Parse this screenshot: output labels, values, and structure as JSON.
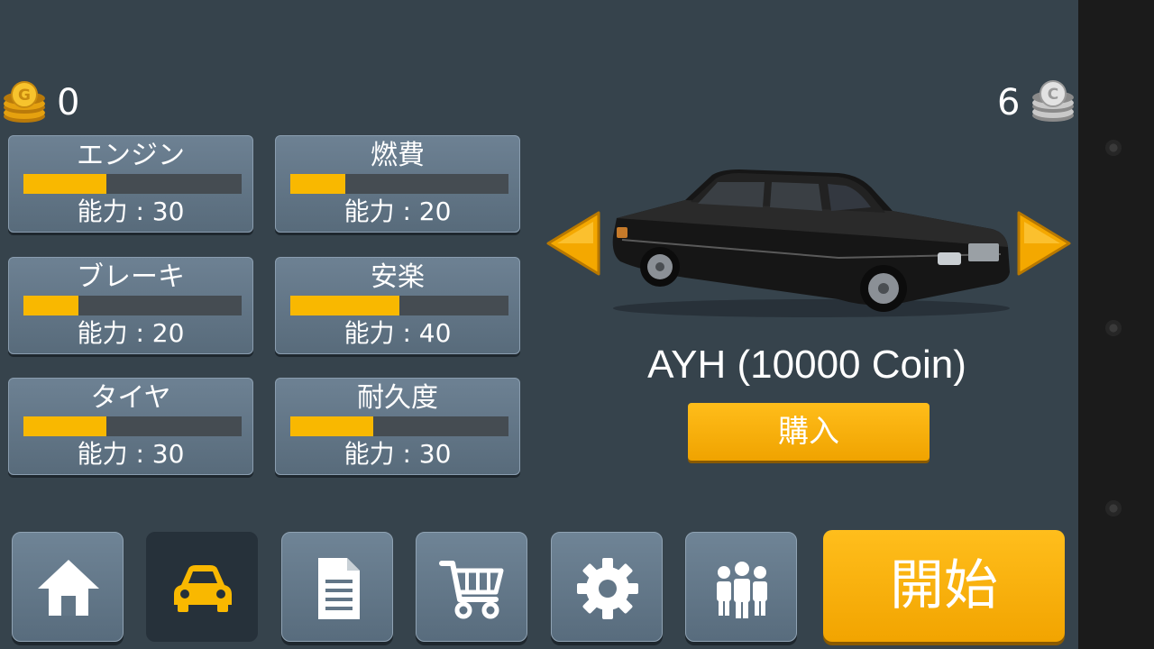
{
  "wallet": {
    "gold_icon": "gold-coin-stack-icon",
    "gold_count": "0",
    "silver_icon": "silver-coin-stack-icon",
    "silver_count": "6"
  },
  "stats": [
    {
      "name": "エンジン",
      "ability": "能力 : 30",
      "level": 0.38
    },
    {
      "name": "燃費",
      "ability": "能力 : 20",
      "level": 0.25
    },
    {
      "name": "ブレーキ",
      "ability": "能力 : 20",
      "level": 0.25
    },
    {
      "name": "安楽",
      "ability": "能力 : 40",
      "level": 0.5
    },
    {
      "name": "タイヤ",
      "ability": "能力 : 30",
      "level": 0.38
    },
    {
      "name": "耐久度",
      "ability": "能力 : 30",
      "level": 0.38
    }
  ],
  "car": {
    "title": "AYH (10000 Coin)",
    "buy_label": "購入",
    "prev_icon": "arrow-left-icon",
    "next_icon": "arrow-right-icon"
  },
  "bottom_nav": {
    "tabs": [
      {
        "icon": "home-icon"
      },
      {
        "icon": "car-icon",
        "active": true
      },
      {
        "icon": "document-icon"
      },
      {
        "icon": "shopping-cart-icon"
      },
      {
        "icon": "gear-icon"
      },
      {
        "icon": "people-icon"
      }
    ],
    "start_label": "開始"
  },
  "colors": {
    "background": "#36434c",
    "accent": "#f9b800",
    "card": "#627687",
    "active_tab": "#26313a"
  }
}
